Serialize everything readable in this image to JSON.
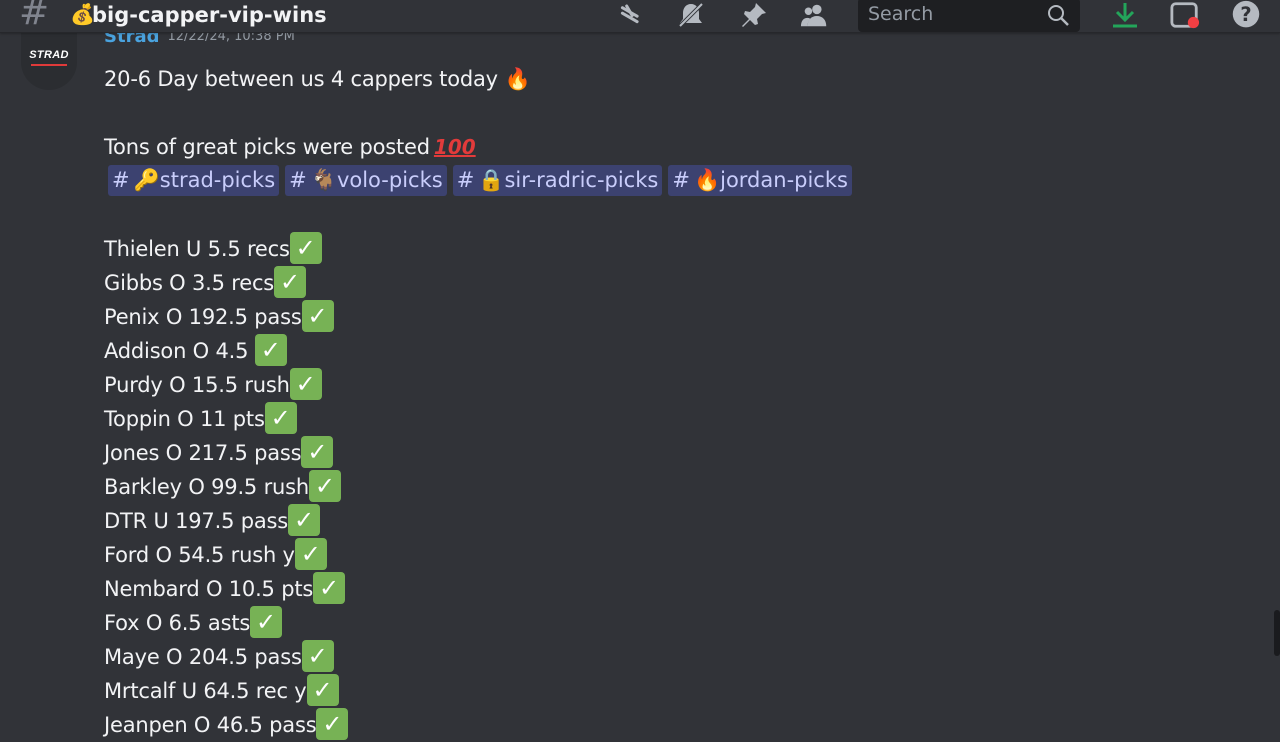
{
  "header": {
    "channel_emoji": "💰",
    "channel_name": "big-capper-vip-wins",
    "icons": [
      "threads-icon",
      "mute-bell-icon",
      "pin-icon",
      "members-icon",
      "download-icon",
      "inbox-icon",
      "help-icon"
    ],
    "search_placeholder": "Search",
    "accent_colors": {
      "download": "#23a55a",
      "notification": "#f23f43"
    }
  },
  "message": {
    "avatar_text": "STRAD",
    "author": "Strad",
    "timestamp": "12/22/24, 10:38 PM",
    "intro_text": "20-6 Day between us 4 cappers today",
    "intro_emoji": "🔥",
    "picks_text": "Tons of great picks were posted",
    "picks_emoji": "💯",
    "mentions": [
      {
        "emoji": "🔑",
        "name": "strad-picks"
      },
      {
        "emoji": "🐐",
        "name": "volo-picks"
      },
      {
        "emoji": "🔒",
        "name": "sir-radric-picks"
      },
      {
        "emoji": "🔥",
        "name": "jordan-picks"
      }
    ],
    "check_glyph": "✓",
    "picks": [
      "Thielen U 5.5 recs",
      "Gibbs O 3.5 recs",
      "Penix O 192.5 pass",
      "Addison O 4.5 ",
      "Purdy O 15.5 rush",
      "Toppin O 11 pts",
      "Jones O 217.5 pass",
      "Barkley O 99.5 rush",
      "DTR U 197.5 pass",
      "Ford O 54.5 rush y",
      "Nembard O 10.5 pts",
      "Fox O 6.5 asts",
      "Maye O 204.5 pass",
      "Mrtcalf U 64.5 rec y",
      "Jeanpen O 46.5 pass"
    ]
  }
}
